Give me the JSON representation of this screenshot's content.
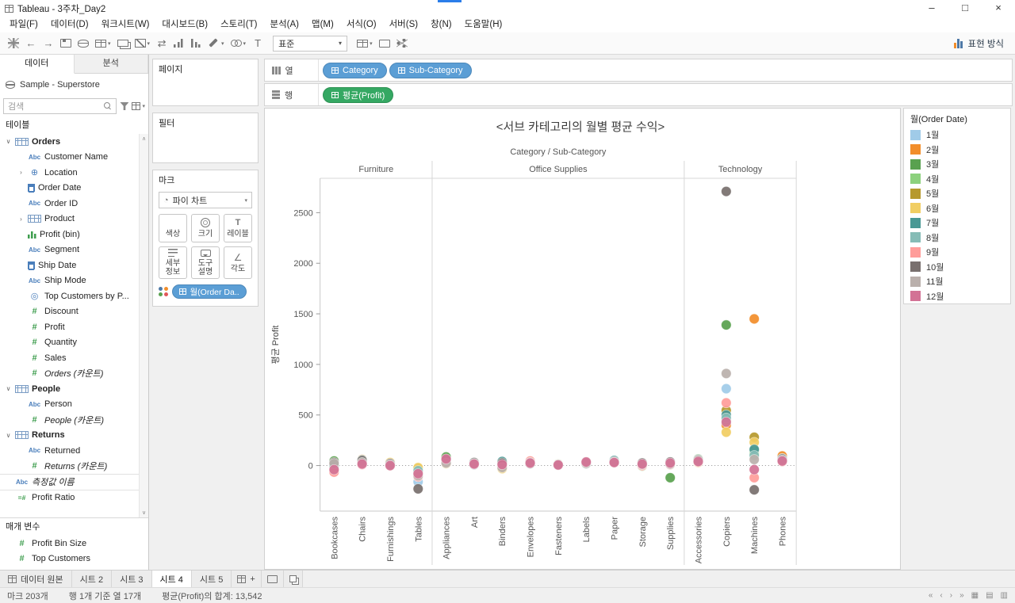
{
  "window": {
    "title": "Tableau - 3주차_Day2"
  },
  "icons": {
    "minimize": "–",
    "maximize": "□",
    "close": "×",
    "caret": "▾",
    "collapse": "∨",
    "expand": "›",
    "scroll_up": "∧",
    "scroll_down": "∨",
    "back": "←",
    "forward": "→",
    "swap": "⇄",
    "pie": "◔",
    "globe": "⊕",
    "set": "◎",
    "abc": "Abc",
    "hash": "#",
    "calc_hash": "=#",
    "label_T": "T",
    "angle": "∠",
    "nav_first": "«",
    "nav_prev": "‹",
    "nav_next": "›",
    "nav_last": "»",
    "view_grid": "▦",
    "view_list": "▤",
    "view_split": "▥",
    "plus": "+"
  },
  "menu": {
    "items": [
      "파일(F)",
      "데이터(D)",
      "워크시트(W)",
      "대시보드(B)",
      "스토리(T)",
      "분석(A)",
      "맵(M)",
      "서식(O)",
      "서버(S)",
      "창(N)",
      "도움말(H)"
    ]
  },
  "toolbar": {
    "buttons_left": [
      {
        "name": "logo",
        "css": "logo"
      },
      {
        "name": "undo",
        "glyph": "←"
      },
      {
        "name": "redo",
        "glyph": "→"
      },
      {
        "name": "save",
        "css": "floppy"
      },
      {
        "name": "new-datasource",
        "css": "db"
      },
      {
        "name": "new-worksheet",
        "css": "grid",
        "caret": true
      },
      {
        "name": "duplicate",
        "css": "dup"
      },
      {
        "name": "clear-sheet",
        "css": "clear",
        "caret": true
      },
      {
        "name": "swap-axes",
        "glyph": "⇄"
      },
      {
        "name": "sort-ascending",
        "css": "sortasc"
      },
      {
        "name": "sort-descending",
        "css": "sortdesc"
      },
      {
        "name": "highlight",
        "css": "pen",
        "caret": true
      },
      {
        "name": "group-members",
        "css": "clip",
        "caret": true
      },
      {
        "name": "show-mark-labels",
        "glyph": "T"
      }
    ],
    "fit_label": "표준",
    "buttons_right": [
      {
        "name": "show-hide-cards",
        "css": "grid",
        "caret": true
      },
      {
        "name": "presentation-mode",
        "css": "screen"
      },
      {
        "name": "share",
        "css": "share"
      }
    ],
    "show_me_label": "표현 방식"
  },
  "data_pane": {
    "tabs": [
      {
        "label": "데이터",
        "active": true
      },
      {
        "label": "분석",
        "active": false
      }
    ],
    "datasource": "Sample - Superstore",
    "search_placeholder": "검색",
    "tables_label": "테이블",
    "fields": [
      {
        "label": "Orders",
        "icon": "table",
        "level": 0,
        "caret": "v",
        "bold": true
      },
      {
        "label": "Customer Name",
        "icon": "abc",
        "level": 1
      },
      {
        "label": "Location",
        "icon": "globe",
        "level": 1,
        "caret": ">"
      },
      {
        "label": "Order Date",
        "icon": "cal",
        "level": 1
      },
      {
        "label": "Order ID",
        "icon": "abc",
        "level": 1
      },
      {
        "label": "Product",
        "icon": "table",
        "level": 1,
        "caret": ">"
      },
      {
        "label": "Profit (bin)",
        "icon": "bin",
        "level": 1
      },
      {
        "label": "Segment",
        "icon": "abc",
        "level": 1
      },
      {
        "label": "Ship Date",
        "icon": "cal",
        "level": 1
      },
      {
        "label": "Ship Mode",
        "icon": "abc",
        "level": 1
      },
      {
        "label": "Top Customers by P...",
        "icon": "set",
        "level": 1
      },
      {
        "label": "Discount",
        "icon": "hash",
        "level": 1
      },
      {
        "label": "Profit",
        "icon": "hash",
        "level": 1
      },
      {
        "label": "Quantity",
        "icon": "hash",
        "level": 1
      },
      {
        "label": "Sales",
        "icon": "hash",
        "level": 1
      },
      {
        "label": "Orders (카운트)",
        "icon": "hash",
        "level": 1,
        "italic": true
      },
      {
        "label": "People",
        "icon": "table",
        "level": 0,
        "caret": "v",
        "bold": true
      },
      {
        "label": "Person",
        "icon": "abc",
        "level": 1
      },
      {
        "label": "People (카운트)",
        "icon": "hash",
        "level": 1,
        "italic": true
      },
      {
        "label": "Returns",
        "icon": "table",
        "level": 0,
        "caret": "v",
        "bold": true
      },
      {
        "label": "Returned",
        "icon": "abc",
        "level": 1
      },
      {
        "label": "Returns (카운트)",
        "icon": "hash",
        "level": 1,
        "italic": true
      },
      {
        "label": "측정값 이름",
        "icon": "abc",
        "level": 0,
        "italic": true,
        "divider": true
      },
      {
        "label": "Profit Ratio",
        "icon": "calc",
        "level": 0,
        "divider": true
      }
    ],
    "parameters_label": "매개 변수",
    "parameters": [
      {
        "label": "Profit Bin Size",
        "icon": "hash"
      },
      {
        "label": "Top Customers",
        "icon": "hash"
      }
    ]
  },
  "cards": {
    "pages_label": "페이지",
    "filters_label": "필터",
    "marks": {
      "label": "마크",
      "mark_type": "파이 차트",
      "buttons": [
        {
          "key": "color",
          "label": "색상"
        },
        {
          "key": "size",
          "label": "크기"
        },
        {
          "key": "label",
          "label": "레이블"
        },
        {
          "key": "detail",
          "label": "세부 정보"
        },
        {
          "key": "tooltip",
          "label": "도구 설명"
        },
        {
          "key": "angle",
          "label": "각도"
        }
      ],
      "pill_label": "월(Order Da..",
      "role_colors": [
        "#4E79A7",
        "#F28E2B",
        "#59A14F",
        "#E15759"
      ]
    }
  },
  "shelves": {
    "columns_label": "열",
    "rows_label": "행",
    "columns_pills": [
      {
        "label": "Category",
        "type": "dimension"
      },
      {
        "label": "Sub-Category",
        "type": "dimension"
      }
    ],
    "rows_pills": [
      {
        "label": "평균(Profit)",
        "type": "measure"
      }
    ]
  },
  "legend": {
    "title": "월(Order Date)",
    "items": [
      {
        "label": "1월",
        "color": "#A0CBE8"
      },
      {
        "label": "2월",
        "color": "#F28E2B"
      },
      {
        "label": "3월",
        "color": "#59A14F"
      },
      {
        "label": "4월",
        "color": "#8CD17D"
      },
      {
        "label": "5월",
        "color": "#B6992D"
      },
      {
        "label": "6월",
        "color": "#F1CE63"
      },
      {
        "label": "7월",
        "color": "#499894"
      },
      {
        "label": "8월",
        "color": "#86BCB6"
      },
      {
        "label": "9월",
        "color": "#FF9D9A"
      },
      {
        "label": "10월",
        "color": "#79706E"
      },
      {
        "label": "11월",
        "color": "#BAB0AC"
      },
      {
        "label": "12월",
        "color": "#D37295"
      }
    ]
  },
  "chart_data": {
    "type": "scatter",
    "title": "<서브 카테고리의 월별 평균 수익>",
    "column_header": "Category / Sub-Category",
    "ylabel": "평균 Profit",
    "yticks": [
      0,
      500,
      1000,
      1500,
      2000,
      2500
    ],
    "ylim": [
      -450,
      2840
    ],
    "months": [
      "1월",
      "2월",
      "3월",
      "4월",
      "5월",
      "6월",
      "7월",
      "8월",
      "9월",
      "10월",
      "11월",
      "12월"
    ],
    "panes": [
      {
        "category": "Furniture",
        "subcategories": [
          "Bookcases",
          "Chairs",
          "Furnishings",
          "Tables"
        ]
      },
      {
        "category": "Office Supplies",
        "subcategories": [
          "Appliances",
          "Art",
          "Binders",
          "Envelopes",
          "Fasteners",
          "Labels",
          "Paper",
          "Storage",
          "Supplies"
        ]
      },
      {
        "category": "Technology",
        "subcategories": [
          "Accessories",
          "Copiers",
          "Machines",
          "Phones"
        ]
      }
    ],
    "values": {
      "Bookcases": [
        10,
        35,
        45,
        20,
        5,
        -5,
        15,
        0,
        -65,
        30,
        20,
        -40
      ],
      "Chairs": [
        30,
        60,
        45,
        25,
        40,
        20,
        55,
        35,
        10,
        50,
        30,
        15
      ],
      "Furnishings": [
        15,
        10,
        20,
        5,
        0,
        30,
        10,
        15,
        5,
        20,
        10,
        0
      ],
      "Tables": [
        -160,
        -40,
        -60,
        -90,
        -30,
        -20,
        -70,
        -50,
        -110,
        -230,
        -100,
        -80
      ],
      "Appliances": [
        40,
        70,
        85,
        30,
        50,
        20,
        60,
        45,
        35,
        55,
        25,
        65
      ],
      "Art": [
        15,
        20,
        25,
        10,
        15,
        20,
        10,
        25,
        15,
        30,
        20,
        15
      ],
      "Binders": [
        0,
        30,
        -10,
        20,
        10,
        -30,
        40,
        15,
        5,
        25,
        -20,
        10
      ],
      "Envelopes": [
        25,
        35,
        30,
        20,
        40,
        25,
        30,
        35,
        45,
        20,
        30,
        25
      ],
      "Fasteners": [
        12,
        8,
        10,
        5,
        15,
        10,
        8,
        12,
        5,
        10,
        8,
        6
      ],
      "Labels": [
        25,
        30,
        20,
        35,
        25,
        30,
        20,
        25,
        30,
        20,
        25,
        35
      ],
      "Paper": [
        35,
        40,
        30,
        45,
        35,
        40,
        50,
        35,
        30,
        40,
        35,
        30
      ],
      "Storage": [
        5,
        15,
        10,
        -5,
        20,
        10,
        15,
        5,
        0,
        25,
        10,
        15
      ],
      "Supplies": [
        20,
        30,
        -120,
        10,
        25,
        15,
        20,
        30,
        10,
        35,
        15,
        25
      ],
      "Accessories": [
        40,
        55,
        65,
        35,
        45,
        30,
        50,
        60,
        35,
        45,
        55,
        40
      ],
      "Copiers": [
        760,
        400,
        1390,
        450,
        545,
        330,
        500,
        470,
        620,
        2710,
        910,
        430
      ],
      "Machines": [
        140,
        1450,
        150,
        120,
        280,
        230,
        160,
        100,
        -120,
        -240,
        60,
        -40
      ],
      "Phones": [
        60,
        95,
        50,
        40,
        55,
        45,
        70,
        50,
        40,
        65,
        55,
        45
      ]
    }
  },
  "tabs_bar": {
    "datasource_label": "데이터 원본",
    "sheets": [
      {
        "label": "시트 2",
        "active": false
      },
      {
        "label": "시트 3",
        "active": false
      },
      {
        "label": "시트 4",
        "active": true
      },
      {
        "label": "시트 5",
        "active": false
      }
    ]
  },
  "status_bar": {
    "marks": "마크 203개",
    "dims": "행 1개 기준 열 17개",
    "agg": "평균(Profit)의 합계: 13,542"
  }
}
